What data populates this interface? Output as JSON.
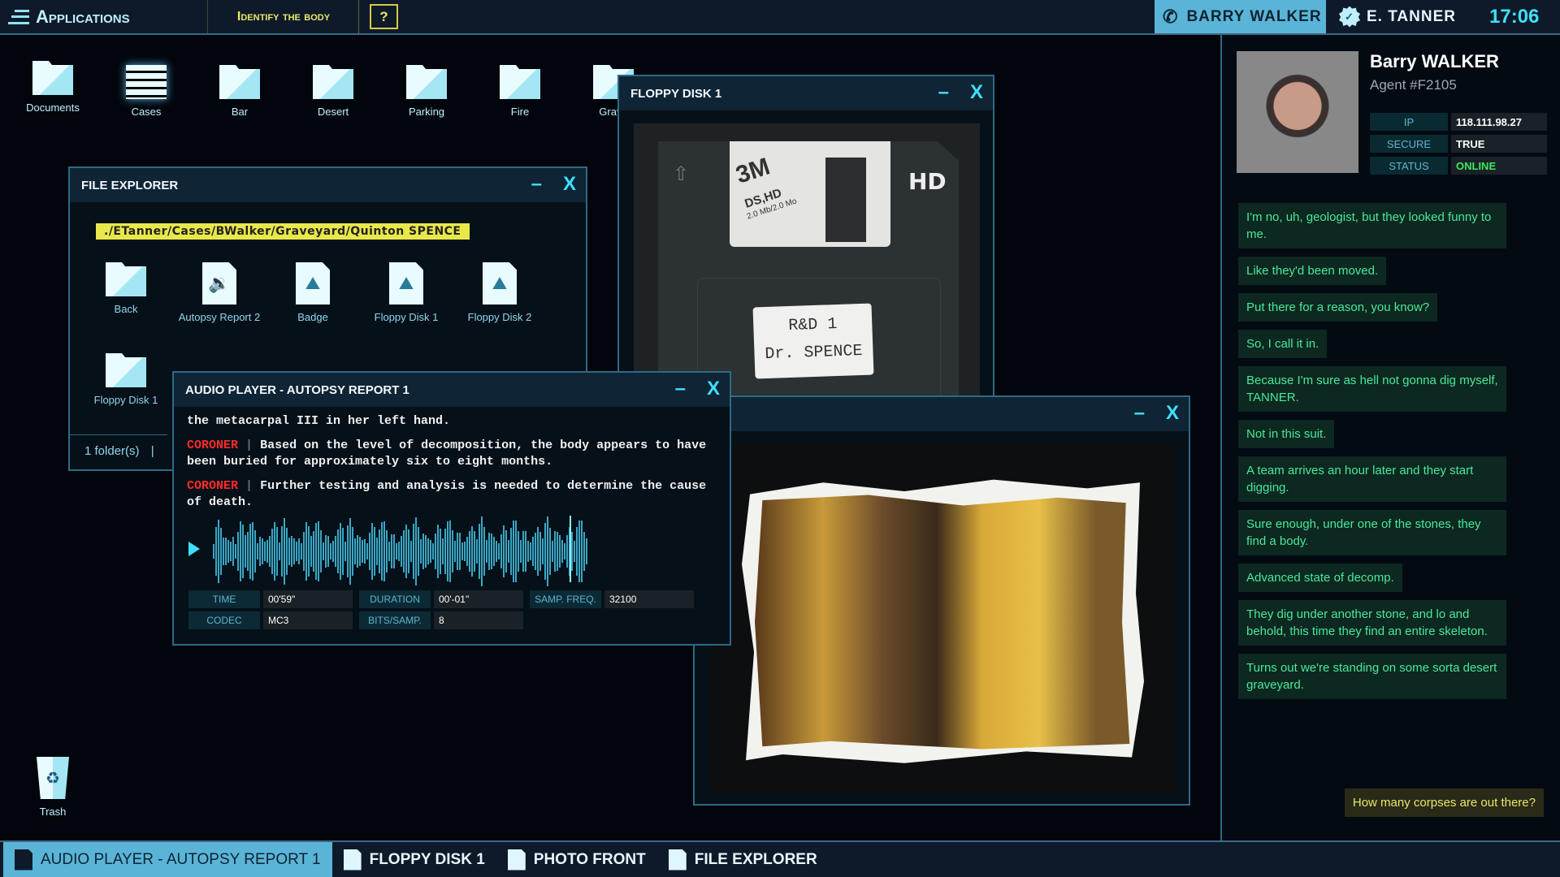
{
  "topbar": {
    "apps_label": "Applications",
    "mission": "Identify the body",
    "help": "?",
    "caller": "BARRY WALKER",
    "user": "E. TANNER",
    "time": "17:06"
  },
  "desktop": {
    "icons": [
      {
        "label": "Documents",
        "icon": "document-folder-icon"
      },
      {
        "label": "Cases",
        "icon": "cases-tray-icon"
      },
      {
        "label": "Bar",
        "icon": "folder-icon"
      },
      {
        "label": "Desert",
        "icon": "folder-icon"
      },
      {
        "label": "Parking",
        "icon": "folder-icon"
      },
      {
        "label": "Fire",
        "icon": "folder-icon"
      },
      {
        "label": "Grave",
        "icon": "folder-icon"
      }
    ],
    "trash": "Trash"
  },
  "file_explorer": {
    "title": "FILE EXPLORER",
    "path": "./ETanner/Cases/BWalker/Graveyard/Quinton SPENCE",
    "items": [
      {
        "label": "Back",
        "icon": "folder-up-icon"
      },
      {
        "label": "Autopsy Report 2",
        "icon": "audio-file-icon"
      },
      {
        "label": "Badge",
        "icon": "image-file-icon"
      },
      {
        "label": "Floppy Disk 1",
        "icon": "image-file-icon"
      },
      {
        "label": "Floppy Disk 2",
        "icon": "image-file-icon"
      },
      {
        "label": "Floppy Disk 1",
        "icon": "folder-icon"
      }
    ],
    "status": "1 folder(s)",
    "status_sep": "|"
  },
  "floppy": {
    "title": "FLOPPY DISK 1",
    "brand": "3M",
    "type": "DS,HD",
    "capacity": "2.0 Mb/2.0 Mo",
    "hd": "HD",
    "label_line1": "R&D 1",
    "label_line2": "Dr. SPENCE"
  },
  "audio": {
    "title": "AUDIO PLAYER - AUTOPSY REPORT 1",
    "lines": [
      {
        "speaker": "",
        "text": "the metacarpal III in her left hand."
      },
      {
        "speaker": "CORONER",
        "text": "Based on the level of decomposition, the body appears to have been buried for approximately six to eight months."
      },
      {
        "speaker": "CORONER",
        "text": "Further testing and analysis is needed to determine the cause of death."
      }
    ],
    "playhead_position": 0.95,
    "fields": {
      "time_label": "TIME",
      "time": "00'59\"",
      "duration_label": "DURATION",
      "duration": "00'-01\"",
      "freq_label": "SAMP. FREQ.",
      "freq": "32100",
      "codec_label": "CODEC",
      "codec": "MC3",
      "bits_label": "BITS/SAMP.",
      "bits": "8"
    }
  },
  "contact": {
    "name": "Barry WALKER",
    "agent": "Agent #F2105",
    "ip_label": "IP",
    "ip": "118.111.98.27",
    "secure_label": "SECURE",
    "secure": "TRUE",
    "status_label": "STATUS",
    "status": "ONLINE",
    "status_color": "#3ee85a"
  },
  "chat": {
    "messages": [
      "I'm no, uh, geologist, but they looked funny to me.",
      "Like they'd been moved.",
      "Put there for a reason, you know?",
      "So, I call it in.",
      "Because I'm sure as hell not gonna dig myself, TANNER.",
      "Not in this suit.",
      "A team arrives an hour later and they start digging.",
      "Sure enough, under one of the stones, they find a body.",
      "Advanced state of decomp.",
      "They dig under another stone, and lo and behold, this time they find an entire skeleton.",
      "Turns out we're standing on some sorta desert graveyard."
    ],
    "reply": "How many corpses are out there?"
  },
  "taskbar": {
    "items": [
      {
        "label": "AUDIO PLAYER - AUTOPSY REPORT 1",
        "active": true
      },
      {
        "label": "FLOPPY DISK 1"
      },
      {
        "label": "PHOTO FRONT"
      },
      {
        "label": "FILE EXPLORER"
      }
    ]
  }
}
